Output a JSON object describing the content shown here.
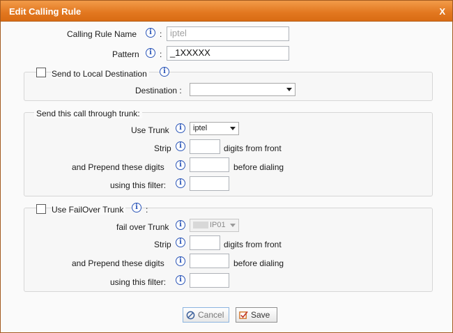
{
  "dialog": {
    "title": "Edit Calling Rule",
    "close_label": "X"
  },
  "rule": {
    "name_label": "Calling Rule Name",
    "colon": ":",
    "name_value": "iptel",
    "pattern_label": "Pattern",
    "pattern_value": "_1XXXXX"
  },
  "local": {
    "checkbox_label": "Send to Local Destination",
    "destination_label": "Destination :",
    "destination_value": ""
  },
  "trunk": {
    "section_label": "Send this call through trunk:",
    "use_trunk_label": "Use Trunk",
    "use_trunk_value": "iptel",
    "strip_label": "Strip",
    "strip_suffix": "digits from front",
    "prepend_label": "and Prepend these digits",
    "prepend_suffix": "before dialing",
    "filter_label": "using this filter:"
  },
  "failover": {
    "checkbox_label": "Use FailOver Trunk",
    "colon": ":",
    "trunk_label": "fail over Trunk",
    "trunk_value": "IP01",
    "strip_label": "Strip",
    "strip_suffix": "digits from front",
    "prepend_label": "and Prepend these digits",
    "prepend_suffix": "before dialing",
    "filter_label": "using this filter:"
  },
  "buttons": {
    "cancel_label": "Cancel",
    "save_label": "Save"
  },
  "icons": {
    "info": "info-icon",
    "cancel": "cancel-icon",
    "save": "save-checkbox-icon"
  },
  "colors": {
    "titlebar": "#e2771f",
    "info_icon": "#2a55b8"
  }
}
